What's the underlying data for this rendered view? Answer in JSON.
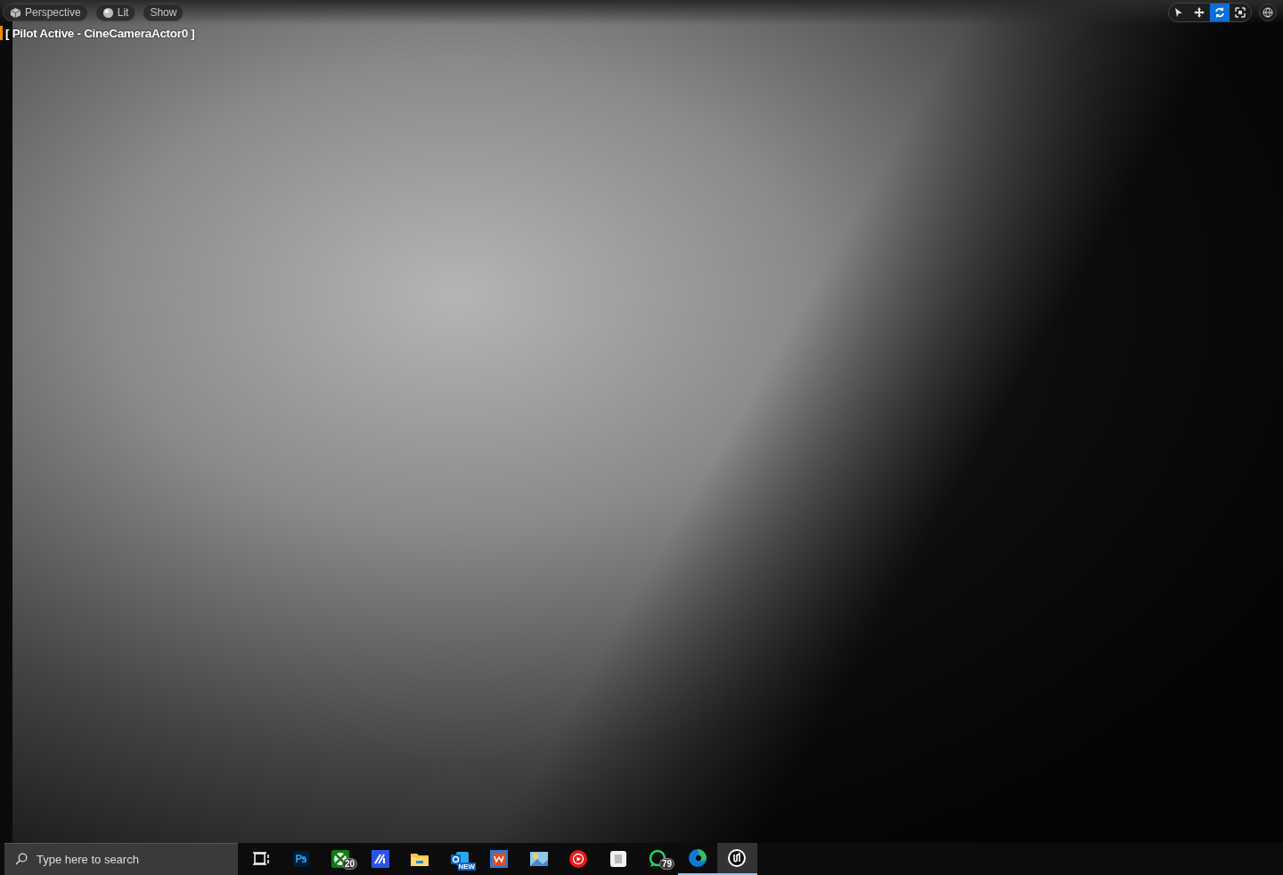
{
  "viewport": {
    "toolbar": [
      {
        "kind": "perspective",
        "label": "Perspective"
      },
      {
        "kind": "lit",
        "label": "Lit"
      },
      {
        "kind": "show",
        "label": "Show"
      }
    ],
    "pilot_label": "[ Pilot Active - CineCameraActor0 ]",
    "transform_tools": [
      {
        "kind": "select",
        "selected": false
      },
      {
        "kind": "move",
        "selected": false
      },
      {
        "kind": "rotate",
        "selected": true
      },
      {
        "kind": "scale",
        "selected": false
      }
    ]
  },
  "taskbar": {
    "search": {
      "placeholder": "Type here to search"
    },
    "apps": [
      {
        "kind": "task-view",
        "running": false,
        "active": false
      },
      {
        "kind": "photoshop",
        "running": false,
        "active": false
      },
      {
        "kind": "xbox",
        "badge": "20",
        "running": false,
        "active": false
      },
      {
        "kind": "editor",
        "running": false,
        "active": false
      },
      {
        "kind": "folder",
        "running": false,
        "active": false
      },
      {
        "kind": "outlook",
        "tag": "NEW",
        "running": false,
        "active": false
      },
      {
        "kind": "office",
        "running": false,
        "active": false
      },
      {
        "kind": "photos",
        "running": false,
        "active": false
      },
      {
        "kind": "youtube-music",
        "running": false,
        "active": false
      },
      {
        "kind": "store",
        "running": false,
        "active": false
      },
      {
        "kind": "whatsapp",
        "badge": "79",
        "running": false,
        "active": false
      },
      {
        "kind": "edge",
        "running": true,
        "active": false
      },
      {
        "kind": "unreal",
        "running": true,
        "active": true
      }
    ]
  }
}
